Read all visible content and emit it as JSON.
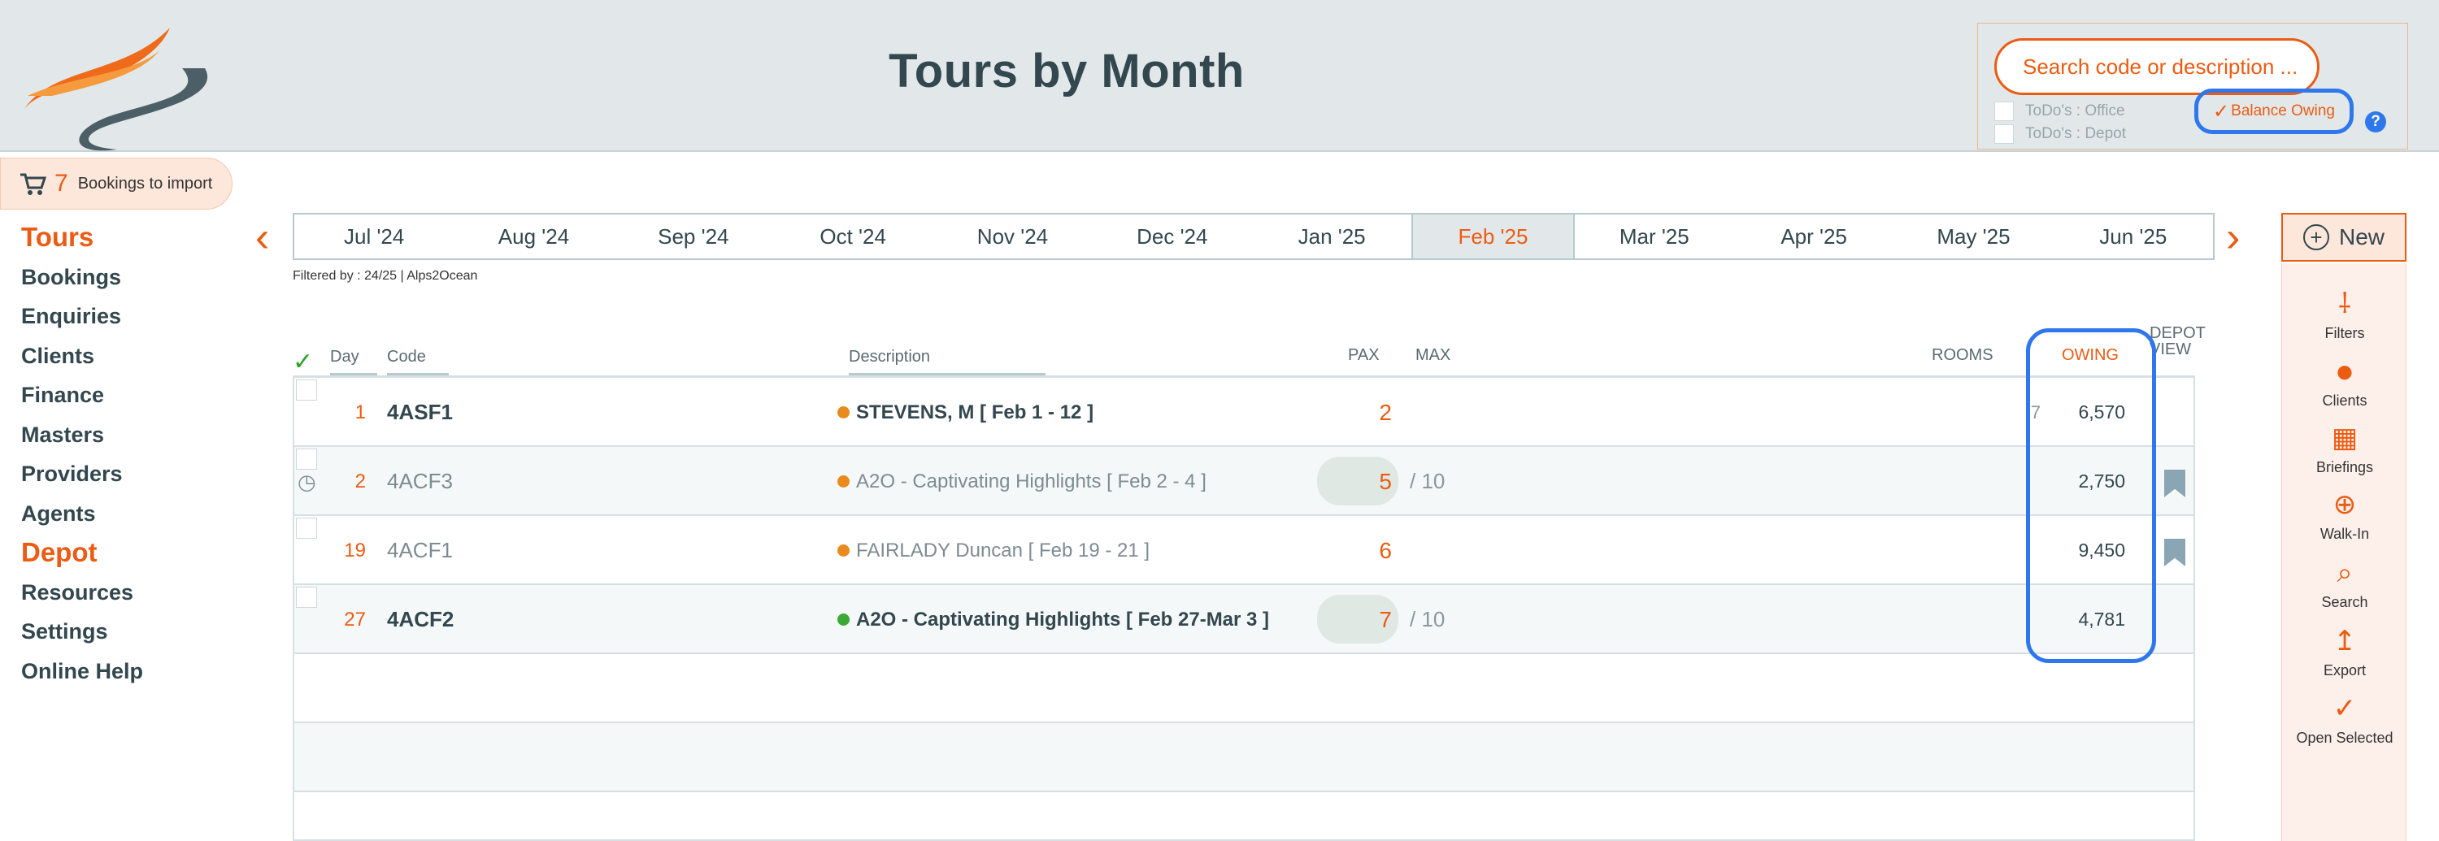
{
  "header": {
    "title": "Tours by Month",
    "search_placeholder": "Search code or description ...",
    "todo_office": "ToDo's : Office",
    "todo_depot": "ToDo's : Depot",
    "balance_owing": "Balance Owing",
    "help": "?"
  },
  "import": {
    "count": "7",
    "label": "Bookings to import"
  },
  "sidebar": {
    "items": [
      {
        "label": "Tours",
        "section": true
      },
      {
        "label": "Bookings"
      },
      {
        "label": "Enquiries"
      },
      {
        "label": "Clients"
      },
      {
        "label": "Finance"
      },
      {
        "label": "Masters"
      },
      {
        "label": "Providers"
      },
      {
        "label": "Agents"
      },
      {
        "label": "Depot",
        "section": true
      },
      {
        "label": "Resources"
      },
      {
        "label": "Settings"
      },
      {
        "label": "Online Help"
      }
    ]
  },
  "months": [
    "Jul '24",
    "Aug '24",
    "Sep '24",
    "Oct '24",
    "Nov '24",
    "Dec '24",
    "Jan '25",
    "Feb '25",
    "Mar '25",
    "Apr '25",
    "May '25",
    "Jun '25"
  ],
  "active_month": "Feb '25",
  "filtered_by": "Filtered by : 24/25 | Alps2Ocean",
  "right_panel": {
    "new_label": "New",
    "tools": [
      {
        "label": "Filters",
        "icon": "filters-icon"
      },
      {
        "label": "Clients",
        "icon": "clients-icon"
      },
      {
        "label": "Briefings",
        "icon": "calendar-icon"
      },
      {
        "label": "Walk-In",
        "icon": "walk-in-icon"
      },
      {
        "label": "Search",
        "icon": "search-icon"
      },
      {
        "label": "Export",
        "icon": "export-icon"
      },
      {
        "label": "Open Selected",
        "icon": "check-icon"
      }
    ]
  },
  "table": {
    "headers": {
      "day": "Day",
      "code": "Code",
      "description": "Description",
      "pax": "PAX",
      "max": "MAX",
      "rooms": "ROOMS",
      "owing": "OWING",
      "depot_view": "DEPOT VIEW"
    },
    "rows": [
      {
        "day": "1",
        "code": "4ASF1",
        "description": "STEVENS, M  [ Feb 1 - 12 ]",
        "pax": "2",
        "max": "",
        "rooms": "7",
        "owing": "6,570",
        "status_color": "#e98a1f",
        "bold": true,
        "history": false,
        "bookmark": false
      },
      {
        "day": "2",
        "code": "4ACF3",
        "description": "A2O - Captivating Highlights  [ Feb 2 - 4 ]",
        "pax": "5",
        "max": "/ 10",
        "rooms": "",
        "owing": "2,750",
        "status_color": "#e98a1f",
        "bold": false,
        "history": true,
        "bookmark": true
      },
      {
        "day": "19",
        "code": "4ACF1",
        "description": "FAIRLADY Duncan  [ Feb 19 - 21 ]",
        "pax": "6",
        "max": "",
        "rooms": "",
        "owing": "9,450",
        "status_color": "#e98a1f",
        "bold": false,
        "history": false,
        "bookmark": true
      },
      {
        "day": "27",
        "code": "4ACF2",
        "description": "A2O - Captivating Highlights  [ Feb 27-Mar 3 ]",
        "pax": "7",
        "max": "/ 10",
        "rooms": "",
        "owing": "4,781",
        "status_color": "#3aa935",
        "bold": true,
        "history": false,
        "bookmark": false
      }
    ]
  }
}
